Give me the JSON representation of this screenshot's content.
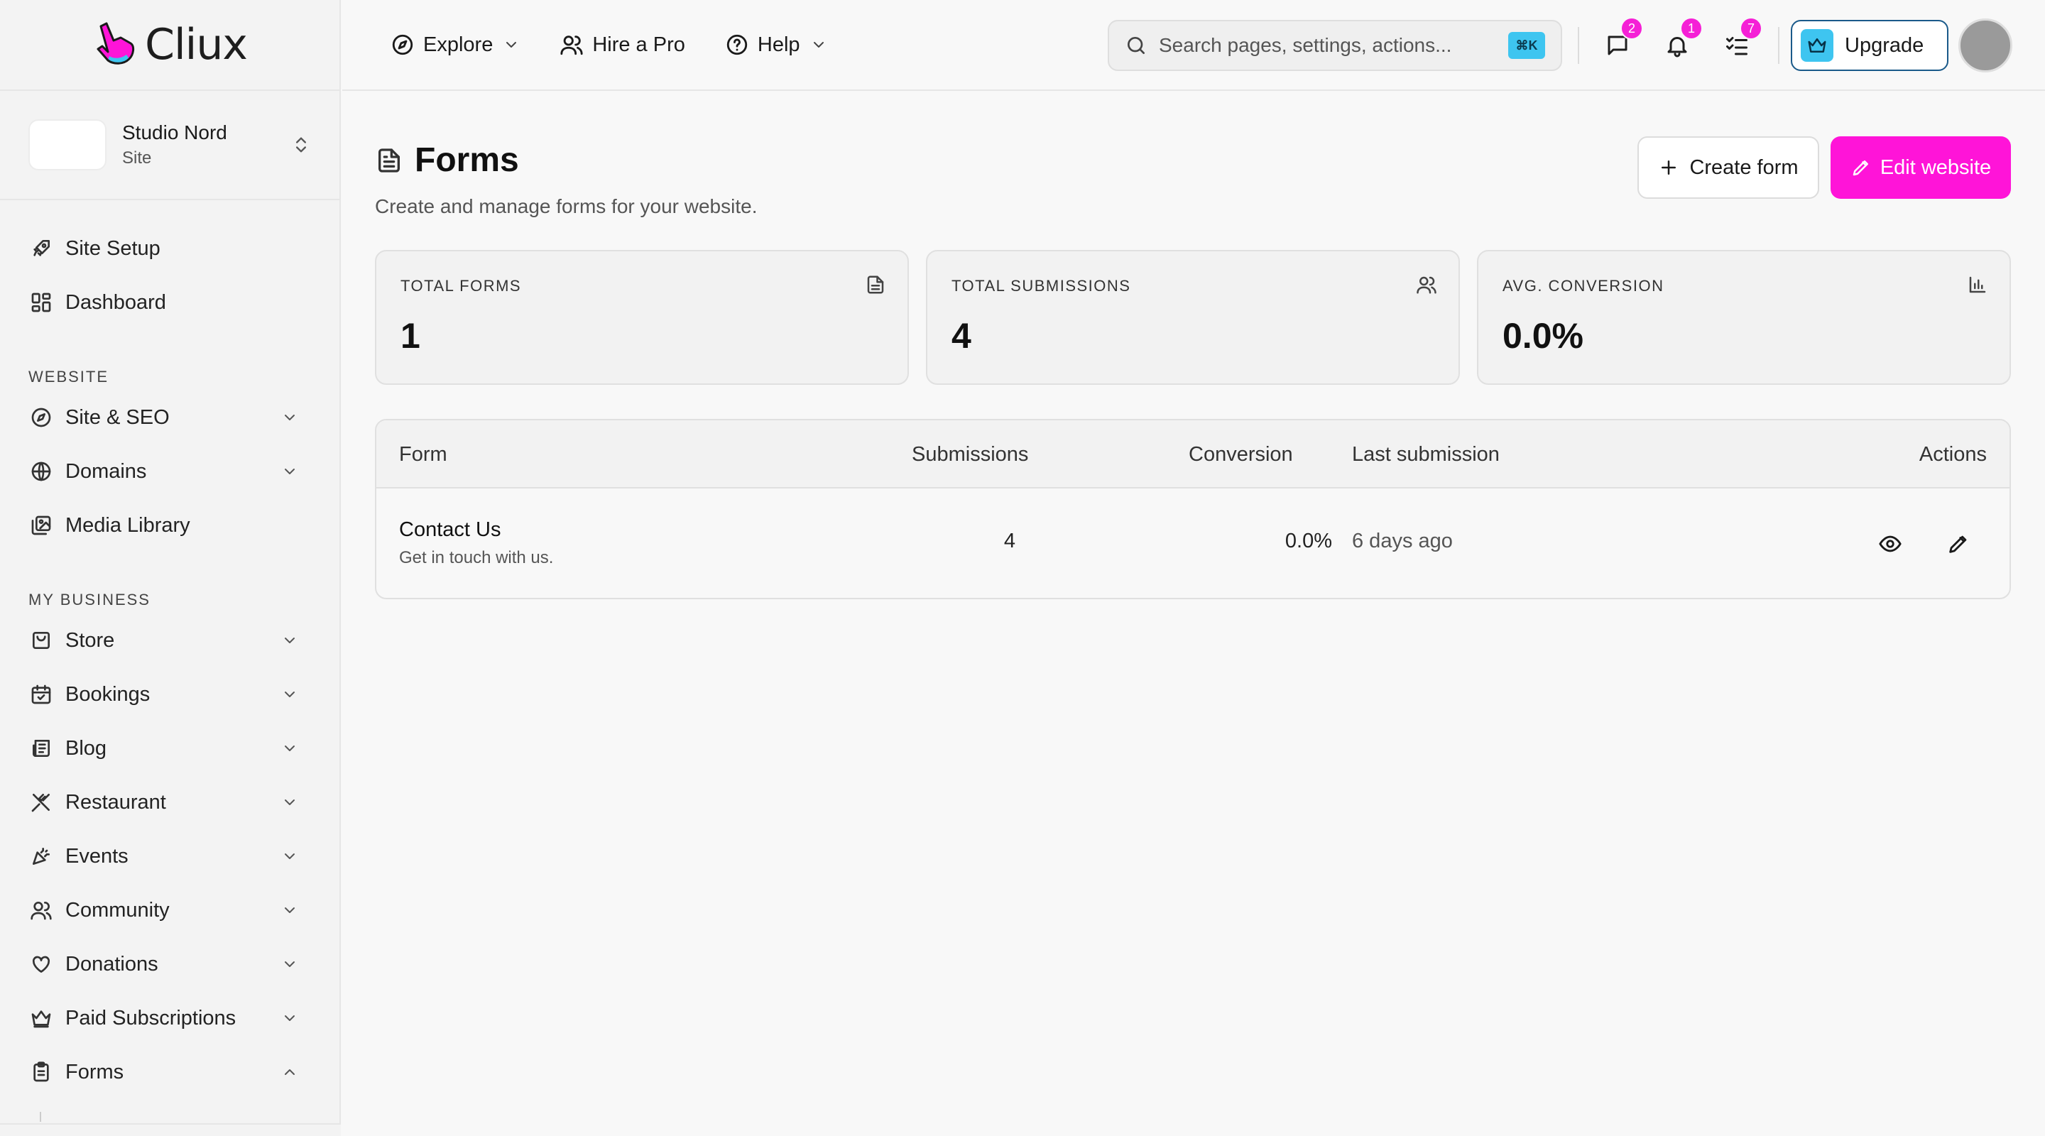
{
  "brand": {
    "name": "Cliux",
    "accent": "#ff14d8",
    "secondary": "#3ec5f0"
  },
  "site": {
    "name": "Studio Nord",
    "type": "Site"
  },
  "topnav": {
    "explore": "Explore",
    "hire": "Hire a Pro",
    "help": "Help"
  },
  "search": {
    "placeholder": "Search pages, settings, actions...",
    "shortcut": "⌘K"
  },
  "notifications": {
    "messages": "2",
    "alerts": "1",
    "tasks": "7"
  },
  "upgrade_label": "Upgrade",
  "sidebar": {
    "top_items": [
      {
        "label": "Site Setup",
        "icon": "rocket-icon"
      },
      {
        "label": "Dashboard",
        "icon": "grid-icon"
      }
    ],
    "website_heading": "WEBSITE",
    "website_items": [
      {
        "label": "Site & SEO",
        "icon": "compass-icon"
      },
      {
        "label": "Domains",
        "icon": "globe-icon"
      },
      {
        "label": "Media Library",
        "icon": "image-icon"
      }
    ],
    "business_heading": "MY BUSINESS",
    "business_items": [
      {
        "label": "Store",
        "icon": "bag-icon"
      },
      {
        "label": "Bookings",
        "icon": "calendar-icon"
      },
      {
        "label": "Blog",
        "icon": "newspaper-icon"
      },
      {
        "label": "Restaurant",
        "icon": "utensils-icon"
      },
      {
        "label": "Events",
        "icon": "party-icon"
      },
      {
        "label": "Community",
        "icon": "users-icon"
      },
      {
        "label": "Donations",
        "icon": "heart-icon"
      },
      {
        "label": "Paid Subscriptions",
        "icon": "crown-icon"
      },
      {
        "label": "Forms",
        "icon": "clipboard-icon"
      }
    ]
  },
  "page": {
    "title": "Forms",
    "subtitle": "Create and manage forms for your website.",
    "create_label": "Create form",
    "edit_label": "Edit website"
  },
  "stats": [
    {
      "label": "TOTAL FORMS",
      "value": "1",
      "icon": "file-icon"
    },
    {
      "label": "TOTAL SUBMISSIONS",
      "value": "4",
      "icon": "users-icon"
    },
    {
      "label": "AVG. CONVERSION",
      "value": "0.0%",
      "icon": "bar-chart-icon"
    }
  ],
  "table": {
    "columns": [
      "Form",
      "Submissions",
      "Conversion",
      "Last submission",
      "Actions"
    ],
    "rows": [
      {
        "name": "Contact Us",
        "description": "Get in touch with us.",
        "submissions": "4",
        "conversion": "0.0%",
        "last_submission": "6 days ago"
      }
    ]
  }
}
